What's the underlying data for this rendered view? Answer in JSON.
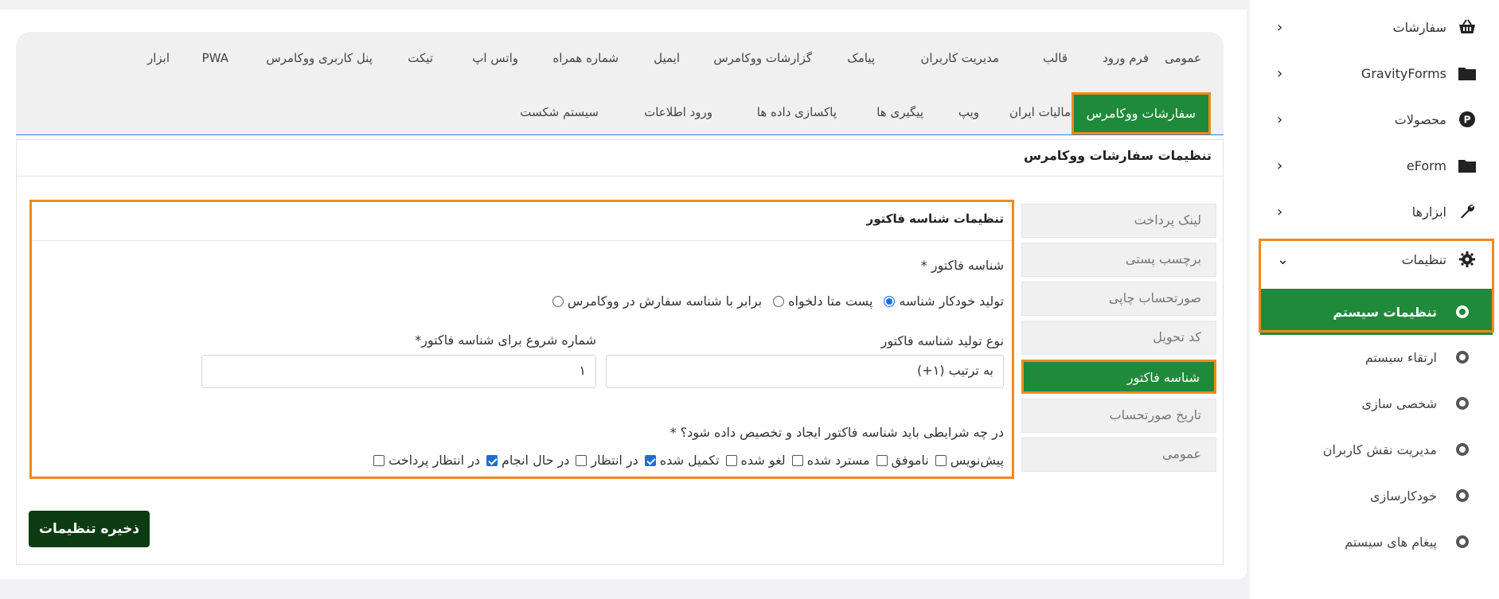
{
  "tabs_row1": [
    "عمومی",
    "فرم ورود",
    "قالب",
    "مدیریت کاربران",
    "پیامک",
    "گزارشات ووکامرس",
    "ایمیل",
    "شماره همراه",
    "واتس اپ",
    "تیکت",
    "پنل کاربری ووکامرس",
    "PWA",
    "ابزار"
  ],
  "tabs_row2": [
    "سفارشات ووکامرس",
    "مالیات ایران",
    "ویپ",
    "پیگیری ها",
    "پاکسازی داده ها",
    "ورود اطلاعات",
    "سیستم شکست"
  ],
  "active_tab": "سفارشات ووکامرس",
  "section_title": "تنظیمات سفارشات ووکامرس",
  "vertical_menu": [
    "لینک پرداخت",
    "برچسب پستی",
    "صورتحساب چاپی",
    "کد تحویل",
    "شناسه فاکتور",
    "تاریخ صورتحساب",
    "عمومی"
  ],
  "vertical_menu_active": "شناسه فاکتور",
  "form": {
    "title": "تنظیمات شناسه فاکتور",
    "invoice_id_label": "شناسه فاکتور *",
    "radio_options": [
      "برابر با شناسه سفارش در ووکامرس",
      "پست متا دلخواه",
      "تولید خودکار شناسه"
    ],
    "radio_selected": "تولید خودکار شناسه",
    "type_label": "نوع تولید شناسه فاکتور",
    "type_value": "به ترتیب (۱+)",
    "start_label": "شماره شروع برای شناسه فاکتور*",
    "start_value": "۱",
    "conditions_label": "در چه شرایطی باید شناسه فاکتور ایجاد و تخصیص داده شود؟ *",
    "checkboxes": [
      {
        "label": "در انتظار پرداخت",
        "checked": false
      },
      {
        "label": "در حال انجام",
        "checked": true
      },
      {
        "label": "در انتظار",
        "checked": false
      },
      {
        "label": "تکمیل شده",
        "checked": true
      },
      {
        "label": "لغو شده",
        "checked": false
      },
      {
        "label": "مسترد شده",
        "checked": false
      },
      {
        "label": "ناموفق",
        "checked": false
      },
      {
        "label": "پیش‌نویس",
        "checked": false
      }
    ]
  },
  "save_label": "ذخیره تنظیمات",
  "sidebar": {
    "items": [
      {
        "label": "سفارشات",
        "icon": "basket-icon"
      },
      {
        "label": "GravityForms",
        "icon": "folder-icon"
      },
      {
        "label": "محصولات",
        "icon": "product-icon"
      },
      {
        "label": "eForm",
        "icon": "folder-icon"
      },
      {
        "label": "ابزارها",
        "icon": "wrench-icon"
      },
      {
        "label": "تنظیمات",
        "icon": "gear-icon"
      }
    ],
    "subitems": [
      "تنظیمات سیستم",
      "ارتقاء سیستم",
      "شخصی سازی",
      "مدیریت نقش کاربران",
      "خودکارسازی",
      "پیغام های سیستم"
    ],
    "active_subitem": "تنظیمات سیستم"
  },
  "colors": {
    "accent_green": "#1f8a3b",
    "highlight_orange": "#f08a1c",
    "save_dark_green": "#0d3b12",
    "checkbox_blue": "#1a6fd6"
  }
}
